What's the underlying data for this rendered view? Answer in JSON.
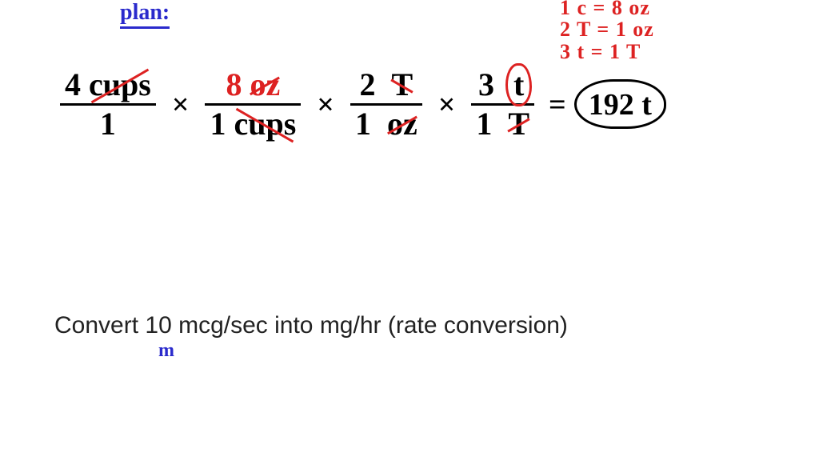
{
  "header": {
    "plan_label": "plan:"
  },
  "conversions": {
    "line1": "1 c = 8 oz",
    "line2": "2 T = 1 oz",
    "line3": "3 t = 1 T"
  },
  "equation": {
    "f1": {
      "num_val": "4",
      "num_unit": "cups",
      "den_val": "1",
      "den_unit": ""
    },
    "f2": {
      "num_val": "8",
      "num_unit": "oz",
      "den_val": "1",
      "den_unit": "cups"
    },
    "f3": {
      "num_val": "2",
      "num_unit": "T",
      "den_val": "1",
      "den_unit": "oz"
    },
    "f4": {
      "num_val": "3",
      "num_unit": "t",
      "den_val": "1",
      "den_unit": "T"
    },
    "times": "×",
    "equals": "=",
    "result": "192 t"
  },
  "problem": {
    "text": "Convert 10 mcg/sec into mg/hr  (rate conversion)",
    "note": "m"
  }
}
